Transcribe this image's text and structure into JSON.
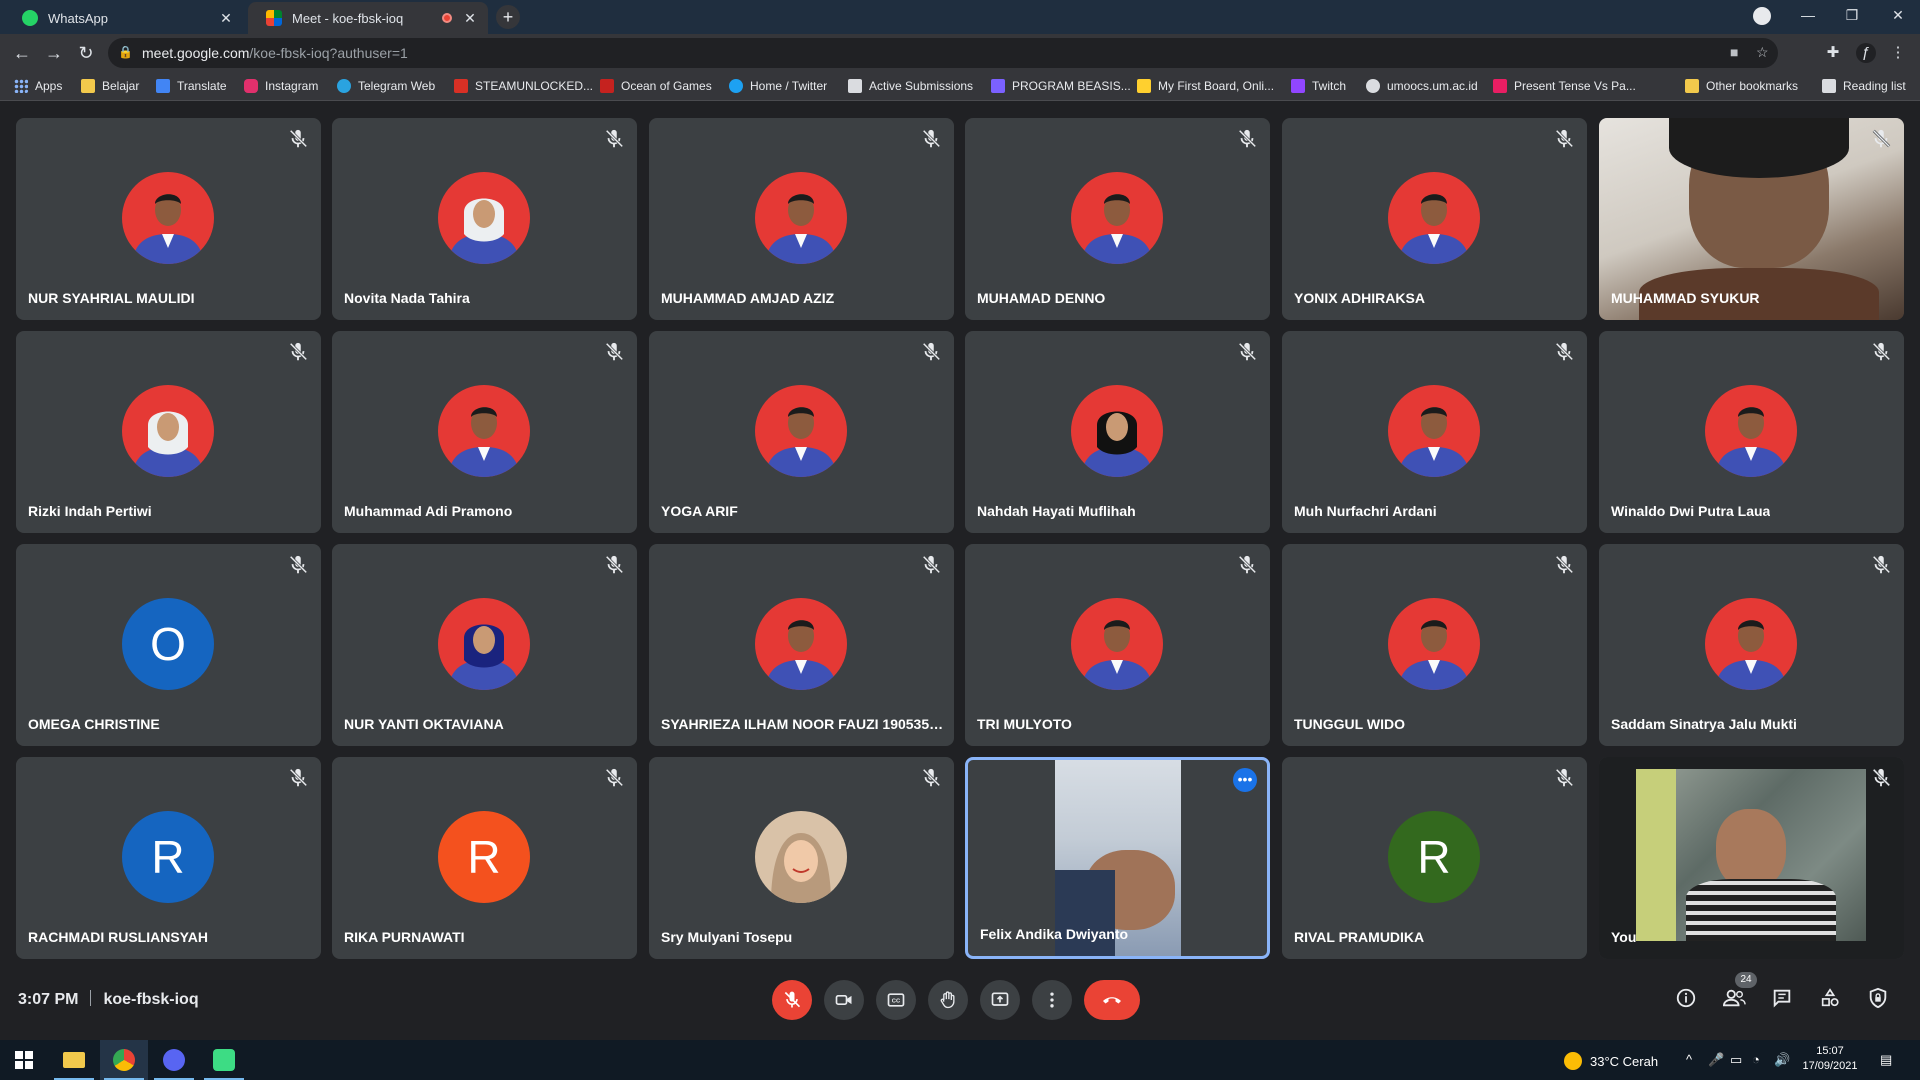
{
  "tabs": [
    {
      "title": "WhatsApp",
      "icon": "whatsapp-icon",
      "active": false
    },
    {
      "title": "Meet - koe-fbsk-ioq",
      "icon": "meet-icon",
      "active": true
    }
  ],
  "address_bar": {
    "host": "meet.google.com",
    "path": "/koe-fbsk-ioq?authuser=1"
  },
  "bookmarks": [
    {
      "label": "Apps",
      "icon": "apps-grid-icon",
      "color": "#8ab4f8"
    },
    {
      "label": "Belajar",
      "icon": "folder-icon",
      "color": "#f2c94c"
    },
    {
      "label": "Translate",
      "icon": "translate-icon",
      "color": "#4285f4"
    },
    {
      "label": "Instagram",
      "icon": "instagram-icon",
      "color": "#e1306c"
    },
    {
      "label": "Telegram Web",
      "icon": "telegram-icon",
      "color": "#2aa3e0"
    },
    {
      "label": "STEAMUNLOCKED...",
      "icon": "steamunlocked-icon",
      "color": "#d93025"
    },
    {
      "label": "Ocean of Games",
      "icon": "ocean-of-games-icon",
      "color": "#c5221f"
    },
    {
      "label": "Home / Twitter",
      "icon": "twitter-icon",
      "color": "#1da1f2"
    },
    {
      "label": "Active Submissions",
      "icon": "submissions-icon",
      "color": "#dadce0"
    },
    {
      "label": "PROGRAM BEASIS...",
      "icon": "program-icon",
      "color": "#7b61ff"
    },
    {
      "label": "My First Board, Onli...",
      "icon": "miro-icon",
      "color": "#ffd02f"
    },
    {
      "label": "Twitch",
      "icon": "twitch-icon",
      "color": "#9146ff"
    },
    {
      "label": "umoocs.um.ac.id",
      "icon": "globe-icon",
      "color": "#dadce0"
    },
    {
      "label": "Present Tense Vs Pa...",
      "icon": "ef-icon",
      "color": "#e91e63"
    },
    {
      "label": "Other bookmarks",
      "icon": "folder-icon",
      "color": "#f2c94c"
    },
    {
      "label": "Reading list",
      "icon": "reading-list-icon",
      "color": "#dadce0"
    }
  ],
  "participants": [
    {
      "name": "NUR SYAHRIAL MAULIDI",
      "avatar": "photo",
      "muted": true
    },
    {
      "name": "Novita Nada Tahira",
      "avatar": "photo-hijab",
      "muted": true
    },
    {
      "name": "MUHAMMAD AMJAD AZIZ",
      "avatar": "photo",
      "muted": true
    },
    {
      "name": "MUHAMAD DENNO",
      "avatar": "photo",
      "muted": true
    },
    {
      "name": "YONIX ADHIRAKSA",
      "avatar": "photo",
      "muted": true
    },
    {
      "name": "MUHAMMAD SYUKUR",
      "avatar": "video",
      "muted": true
    },
    {
      "name": "Rizki Indah Pertiwi",
      "avatar": "photo-hijab",
      "muted": true
    },
    {
      "name": "Muhammad Adi Pramono",
      "avatar": "photo",
      "muted": true
    },
    {
      "name": "YOGA ARIF",
      "avatar": "photo",
      "muted": true
    },
    {
      "name": "Nahdah Hayati Muflihah",
      "avatar": "photo-hijab-dark",
      "muted": true
    },
    {
      "name": "Muh Nurfachri Ardani",
      "avatar": "photo",
      "muted": true
    },
    {
      "name": "Winaldo Dwi Putra Laua",
      "avatar": "photo",
      "muted": true
    },
    {
      "name": "OMEGA CHRISTINE",
      "avatar": "letter",
      "letter": "O",
      "color": "#1565c0",
      "muted": true
    },
    {
      "name": "NUR YANTI OKTAVIANA",
      "avatar": "photo-hijab-blue",
      "muted": true
    },
    {
      "name": "SYAHRIEZA ILHAM NOOR FAUZI 1905351...",
      "avatar": "photo",
      "muted": true
    },
    {
      "name": "TRI MULYOTO",
      "avatar": "photo",
      "muted": true
    },
    {
      "name": "TUNGGUL WIDO",
      "avatar": "photo",
      "muted": true
    },
    {
      "name": "Saddam Sinatrya Jalu Mukti",
      "avatar": "photo",
      "muted": true
    },
    {
      "name": "RACHMADI RUSLIANSYAH",
      "avatar": "letter",
      "letter": "R",
      "color": "#1565c0",
      "muted": true
    },
    {
      "name": "RIKA PURNAWATI",
      "avatar": "letter",
      "letter": "R",
      "color": "#f4511e",
      "muted": true
    },
    {
      "name": "Sry Mulyani Tosepu",
      "avatar": "photo-beige",
      "muted": true
    },
    {
      "name": "Felix Andika Dwiyanto",
      "avatar": "video-portrait",
      "muted": false,
      "speaking": true
    },
    {
      "name": "RIVAL PRAMUDIKA",
      "avatar": "letter",
      "letter": "R",
      "color": "#33691e",
      "muted": true
    },
    {
      "name": "You",
      "avatar": "video-self",
      "muted": true
    }
  ],
  "meeting": {
    "time": "3:07 PM",
    "code": "koe-fbsk-ioq",
    "people_count": "24"
  },
  "colors": {
    "accent": "#8ab4f8",
    "danger": "#ea4335",
    "tile_bg": "#3c4043",
    "avatar_red": "#e53935",
    "shirt_blue": "#3f51b5"
  },
  "taskbar": {
    "weather": "33°C  Cerah",
    "time": "15:07",
    "date": "17/09/2021"
  }
}
